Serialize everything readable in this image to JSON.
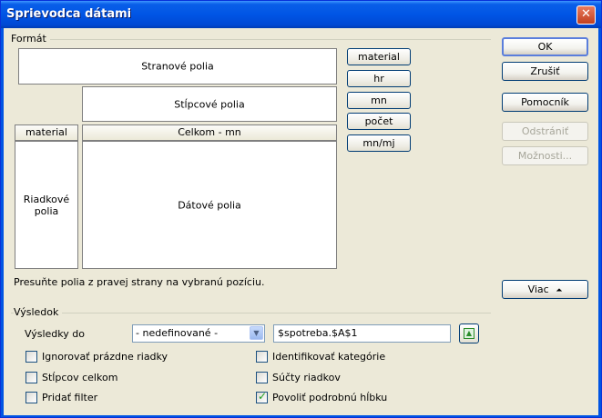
{
  "window": {
    "title": "Sprievodca dátami",
    "close_icon": "close-icon"
  },
  "format_group": {
    "label": "Formát",
    "page_fields": "Stranové polia",
    "column_fields": "Stĺpcové polia",
    "row_field_header": "material",
    "data_field_header": "Celkom - mn",
    "row_fields_line1": "Riadkové",
    "row_fields_line2": "polia",
    "data_fields": "Dátové polia",
    "available_fields": [
      "material",
      "hr",
      "mn",
      "počet",
      "mn/mj"
    ],
    "hint": "Presuňte polia z pravej strany na vybranú pozíciu."
  },
  "buttons": {
    "ok": "OK",
    "cancel": "Zrušiť",
    "help": "Pomocník",
    "remove": "Odstrániť",
    "options": "Možnosti...",
    "more": "Viac",
    "more_icon": "double-chevron-up-icon"
  },
  "result_group": {
    "label": "Výsledok",
    "output_label": "Výsledky do",
    "output_select": "- nedefinované -",
    "output_range": "$spotreba.$A$1",
    "shrink_icon": "shrink-range-icon"
  },
  "options": {
    "ignore_empty": {
      "label": "Ignorovať prázdne riadky",
      "checked": false
    },
    "identify_categories": {
      "label": "Identifikovať kategórie",
      "checked": false
    },
    "total_columns": {
      "label": "Stĺpcov celkom",
      "checked": false
    },
    "total_rows": {
      "label": "Súčty riadkov",
      "checked": false
    },
    "add_filter": {
      "label": "Pridať filter",
      "checked": false
    },
    "enable_drill": {
      "label": "Povoliť podrobnú hĺbku",
      "checked": true
    }
  }
}
